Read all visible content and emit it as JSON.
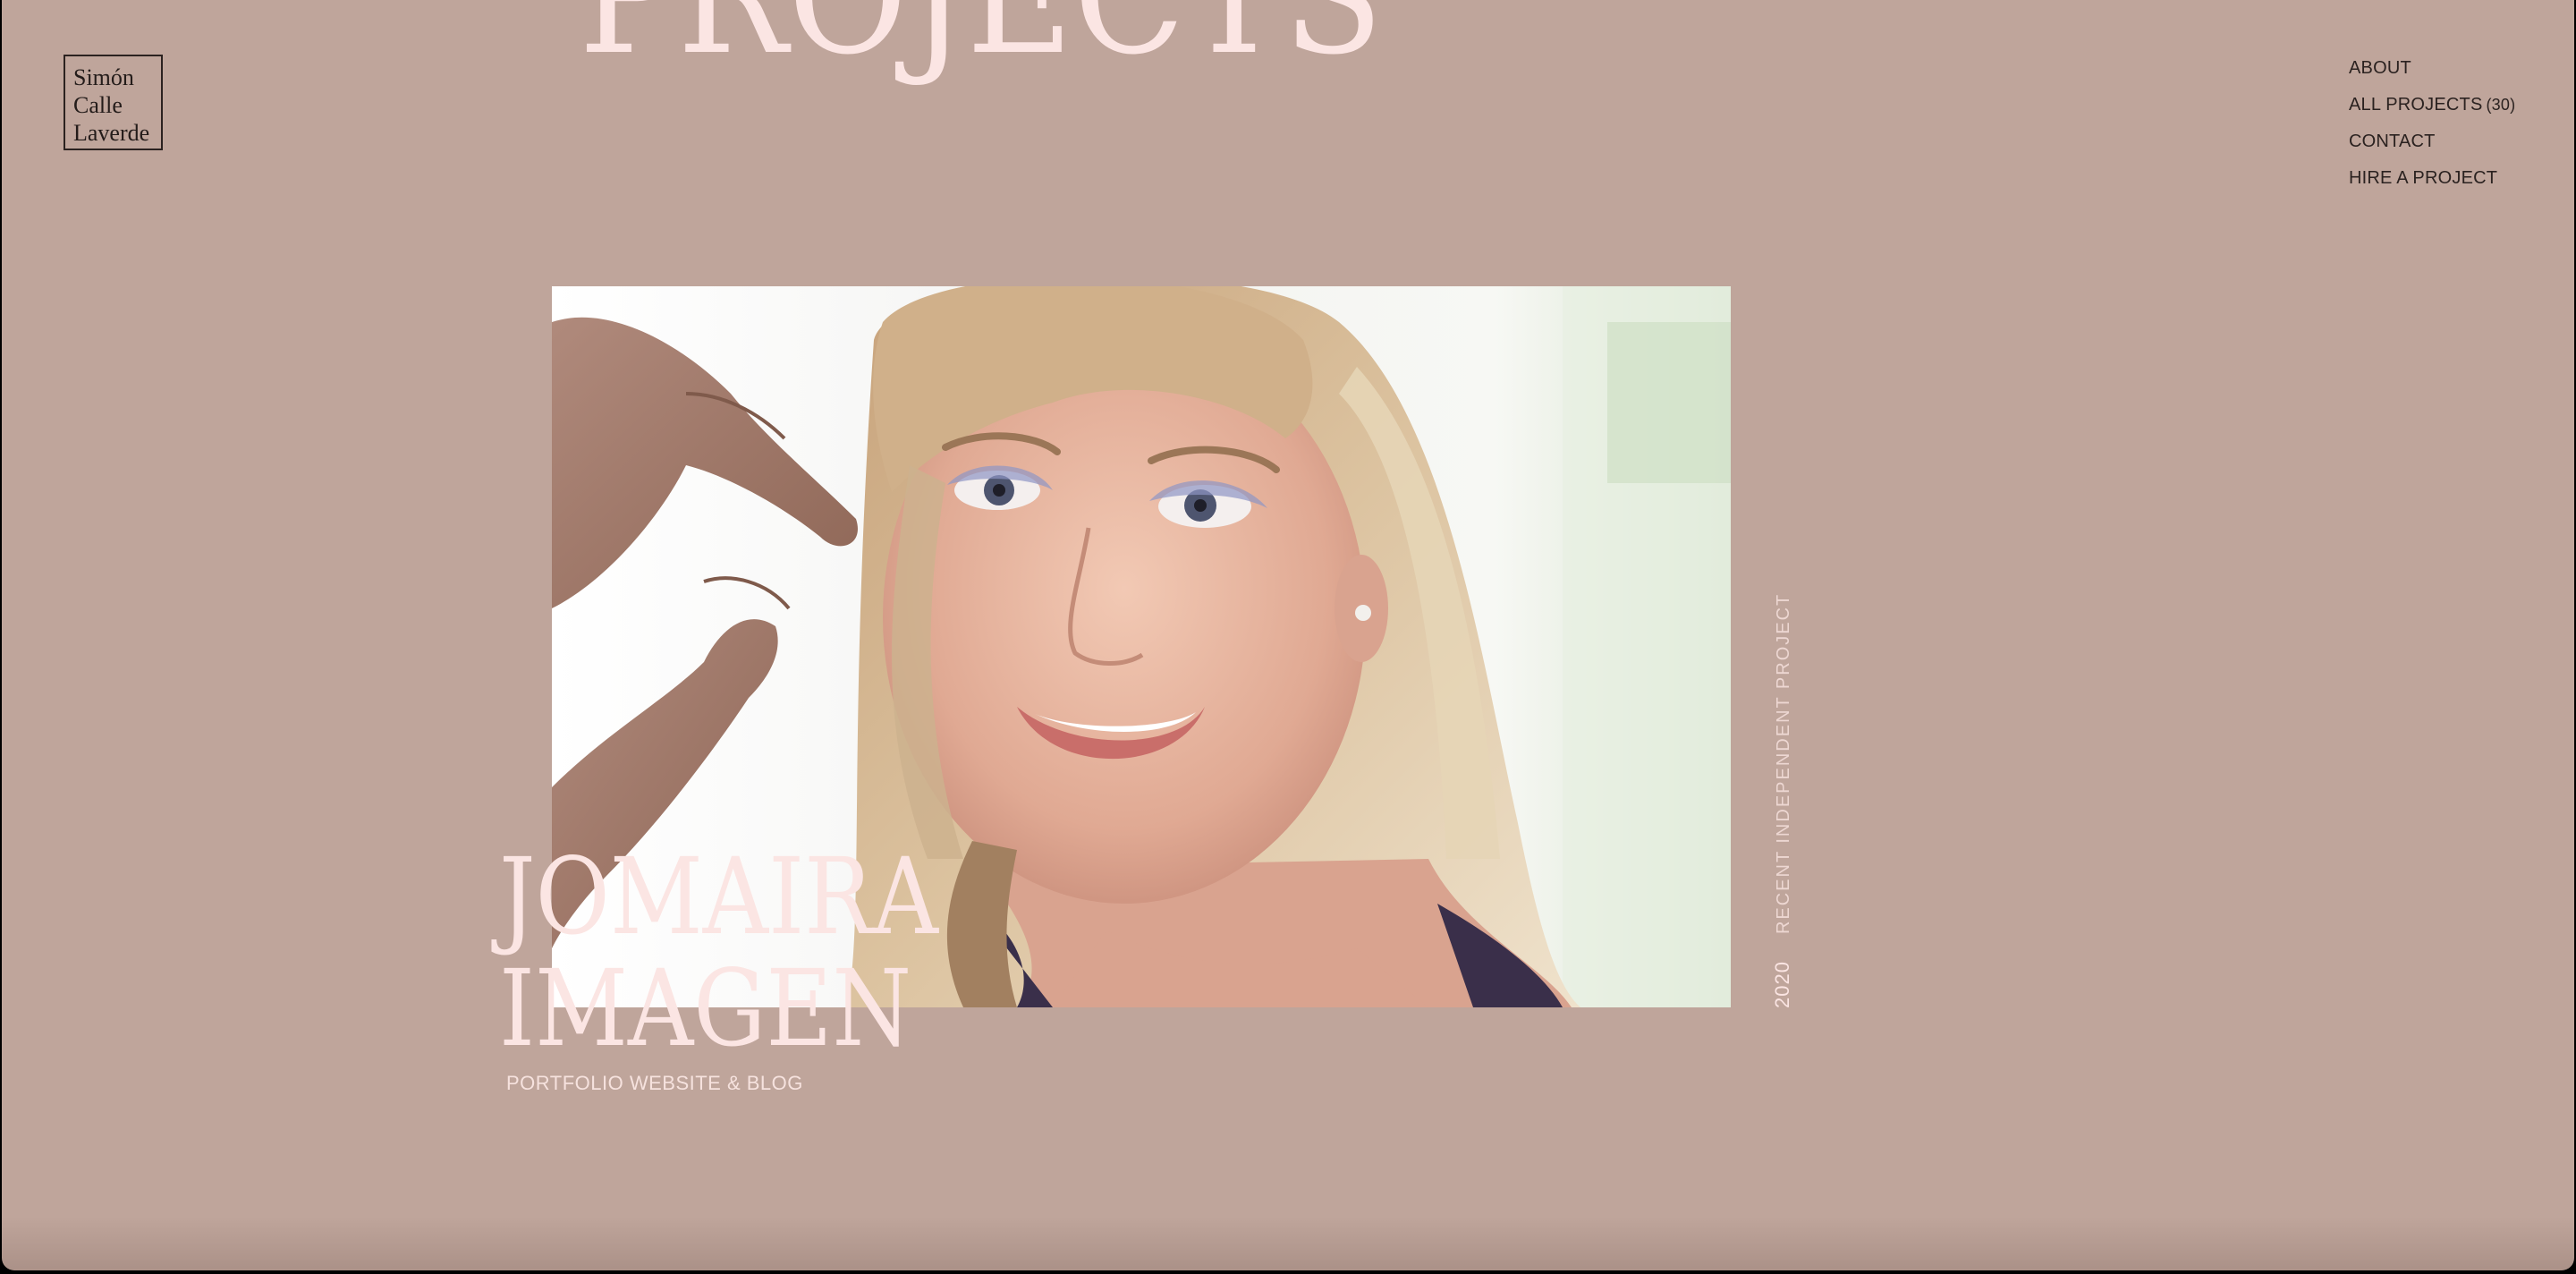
{
  "page": {
    "heading": "PROJECTS"
  },
  "logo": {
    "line1": "Simón",
    "line2": "Calle",
    "line3": "Laverde"
  },
  "nav": {
    "about": "ABOUT",
    "all_projects": "ALL PROJECTS",
    "all_projects_count": "(30)",
    "contact": "CONTACT",
    "hire": "HIRE A PROJECT"
  },
  "featured": {
    "image_alt": "Smiling woman with blonde hair and blue eyeshadow having her hair adjusted",
    "year": "2020",
    "label": "RECENT INDEPENDENT PROJECT",
    "title_line1": "JOMAIRA",
    "title_line2": "IMAGEN",
    "subtitle": "PORTFOLIO WEBSITE & BLOG"
  },
  "colors": {
    "background": "#bfa59b",
    "accent_text": "#fbe5e3",
    "dark_text": "#2b2220"
  }
}
